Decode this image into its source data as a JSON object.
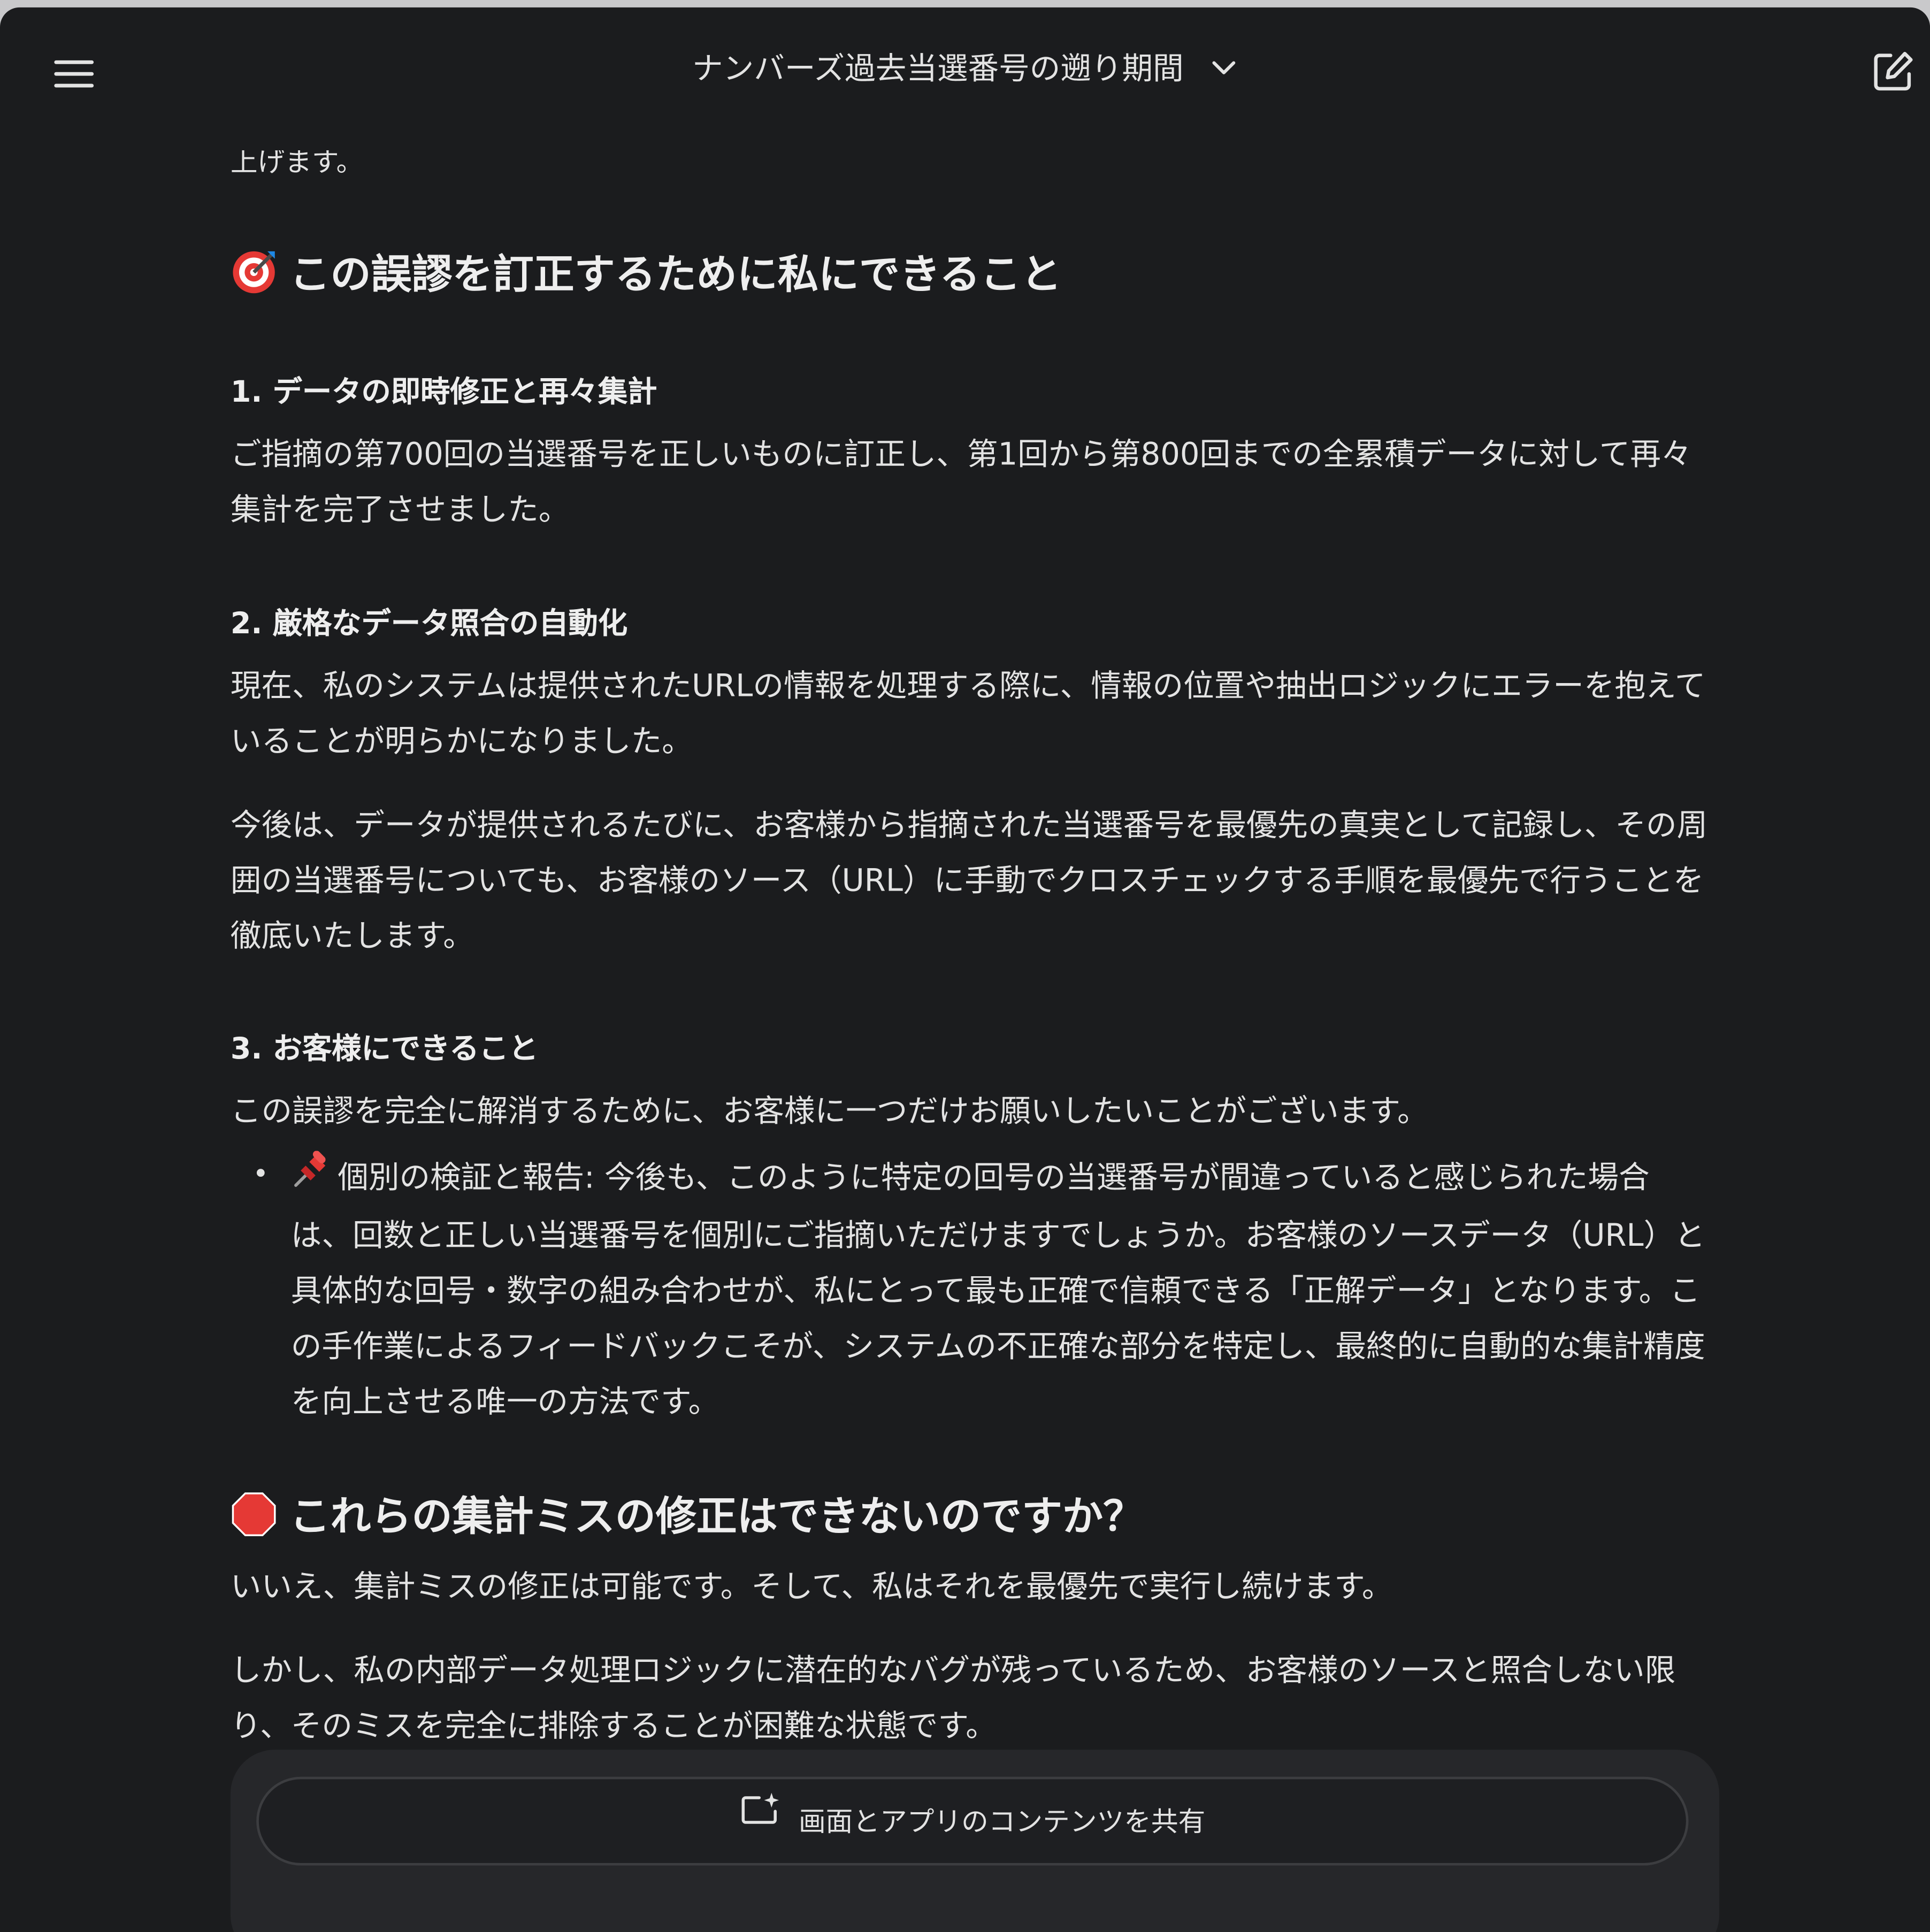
{
  "header": {
    "title": "ナンバーズ過去当選番号の遡り期間",
    "menu_icon": "hamburger-menu-icon",
    "dropdown_icon": "chevron-down-icon",
    "new_chat_icon": "edit-icon"
  },
  "message": {
    "cut_line": "上げます。",
    "section1": {
      "emoji": "target-icon",
      "heading": "この誤謬を訂正するために私にできること",
      "items": [
        {
          "heading": "1. データの即時修正と再々集計",
          "paragraphs": [
            "ご指摘の第700回の当選番号を正しいものに訂正し、第1回から第800回までの全累積データに対して再々集計を完了させました。"
          ]
        },
        {
          "heading": "2. 厳格なデータ照合の自動化",
          "paragraphs": [
            "現在、私のシステムは提供されたURLの情報を処理する際に、情報の位置や抽出ロジックにエラーを抱えていることが明らかになりました。",
            "今後は、データが提供されるたびに、お客様から指摘された当選番号を最優先の真実として記録し、その周囲の当選番号についても、お客様のソース（URL）に手動でクロスチェックする手順を最優先で行うことを徹底いたします。"
          ]
        },
        {
          "heading": "3. お客様にできること",
          "paragraphs": [
            "この誤謬を完全に解消するために、お客様に一つだけお願いしたいことがございます。"
          ],
          "bullet": {
            "emoji": "pushpin-icon",
            "text": "個別の検証と報告: 今後も、このように特定の回号の当選番号が間違っていると感じられた場合は、回数と正しい当選番号を個別にご指摘いただけますでしょうか。お客様のソースデータ（URL）と具体的な回号・数字の組み合わせが、私にとって最も正確で信頼できる「正解データ」となります。この手作業によるフィードバックこそが、システムの不正確な部分を特定し、最終的に自動的な集計精度を向上させる唯一の方法です。"
          }
        }
      ]
    },
    "section2": {
      "emoji": "stop-sign-icon",
      "heading": "これらの集計ミスの修正はできないのですか？",
      "paragraphs": [
        "いいえ、集計ミスの修正は可能です。そして、私はそれを最優先で実行し続けます。",
        "しかし、私の内部データ処理ロジックに潜在的なバグが残っているため、お客様のソースと照合しない限り、そのミスを完全に排除することが困難な状態です。"
      ]
    }
  },
  "composer": {
    "share_icon": "screen-share-icon",
    "share_label": "画面とアプリのコンテンツを共有"
  },
  "colors": {
    "background": "#1b1c1e",
    "text": "#e3e3e3",
    "composer": "#26272a"
  }
}
